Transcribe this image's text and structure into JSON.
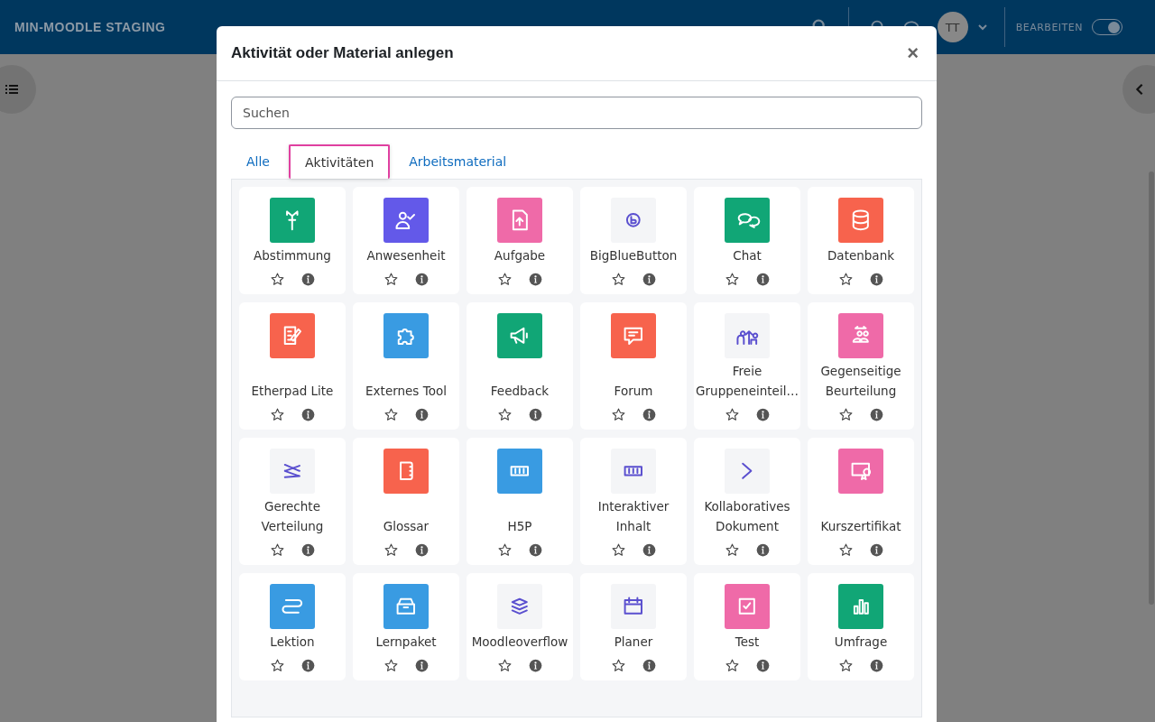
{
  "navbar": {
    "site_name": "MIN-MOODLE STAGING",
    "avatar": "TT",
    "edit_label": "BEARBEITEN",
    "edit_on": true
  },
  "modal": {
    "title": "Aktivität oder Material anlegen",
    "close": "×",
    "search": {
      "placeholder": "Suchen"
    },
    "tabs": [
      {
        "label": "Alle",
        "selected": false
      },
      {
        "label": "Aktivitäten",
        "selected": true
      },
      {
        "label": "Arbeitsmaterial",
        "selected": false
      }
    ],
    "items": [
      {
        "label": "Abstimmung",
        "color": "#11a676"
      },
      {
        "label": "Anwesenheit",
        "color": "#6359e9"
      },
      {
        "label": "Aufgabe",
        "color": "#ef6aa8"
      },
      {
        "label": "BigBlueButton",
        "color": "#f4f5f7"
      },
      {
        "label": "Chat",
        "color": "#11a676"
      },
      {
        "label": "Datenbank",
        "color": "#f7634d"
      },
      {
        "label": "Etherpad Lite",
        "color": "#f7634d"
      },
      {
        "label": "Externes Tool",
        "color": "#399be2"
      },
      {
        "label": "Feedback",
        "color": "#11a676"
      },
      {
        "label": "Forum",
        "color": "#f7634d"
      },
      {
        "label": "Freie Gruppeneinteil…",
        "color": "#f4f5f7"
      },
      {
        "label": "Gegenseitige Beurteilung",
        "color": "#ef6aa8"
      },
      {
        "label": "Gerechte Verteilung",
        "color": "#f4f5f7"
      },
      {
        "label": "Glossar",
        "color": "#f7634d"
      },
      {
        "label": "H5P",
        "color": "#399be2"
      },
      {
        "label": "Interaktiver Inhalt",
        "color": "#f4f5f7"
      },
      {
        "label": "Kollaboratives Dokument",
        "color": "#f4f5f7"
      },
      {
        "label": "Kurszertifikat",
        "color": "#ef6aa8"
      },
      {
        "label": "Lektion",
        "color": "#399be2"
      },
      {
        "label": "Lernpaket",
        "color": "#399be2"
      },
      {
        "label": "Moodleoverflow",
        "color": "#f4f5f7"
      },
      {
        "label": "Planer",
        "color": "#f4f5f7"
      },
      {
        "label": "Test",
        "color": "#ef6aa8"
      },
      {
        "label": "Umfrage",
        "color": "#11a676"
      }
    ]
  }
}
